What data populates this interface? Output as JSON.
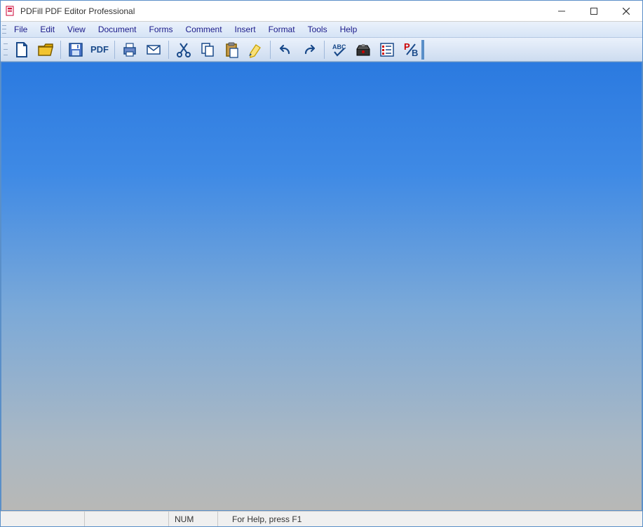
{
  "titlebar": {
    "title": "PDFill PDF Editor Professional"
  },
  "menubar": {
    "items": [
      "File",
      "Edit",
      "View",
      "Document",
      "Forms",
      "Comment",
      "Insert",
      "Format",
      "Tools",
      "Help"
    ]
  },
  "toolbar": {
    "pdf_label": "PDF"
  },
  "statusbar": {
    "num": "NUM",
    "help": "For Help, press F1"
  }
}
